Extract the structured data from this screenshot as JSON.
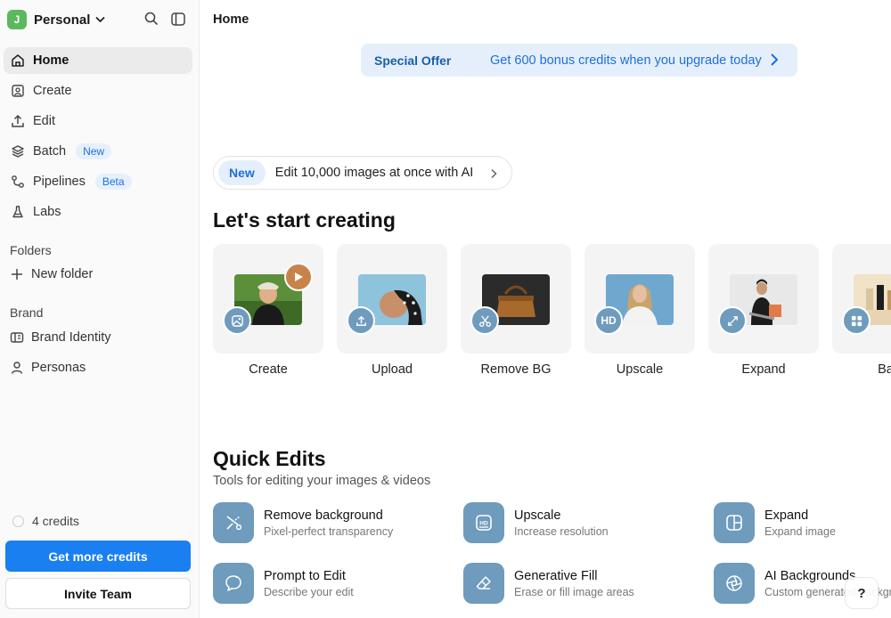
{
  "workspace": {
    "avatar_letter": "J",
    "name": "Personal"
  },
  "nav": [
    {
      "label": "Home",
      "icon": "home-icon",
      "active": true
    },
    {
      "label": "Create",
      "icon": "image-frame-icon"
    },
    {
      "label": "Edit",
      "icon": "upload-icon"
    },
    {
      "label": "Batch",
      "icon": "layers-icon",
      "badge": "New"
    },
    {
      "label": "Pipelines",
      "icon": "pipeline-icon",
      "badge": "Beta"
    },
    {
      "label": "Labs",
      "icon": "flask-icon"
    }
  ],
  "folders": {
    "heading": "Folders",
    "new_folder": "New folder"
  },
  "brand": {
    "heading": "Brand",
    "items": [
      "Brand Identity",
      "Personas"
    ]
  },
  "sidebar_footer": {
    "credits": "4 credits",
    "get_more": "Get more credits",
    "invite": "Invite Team"
  },
  "main": {
    "page_title": "Home",
    "offer": {
      "title": "Special Offer",
      "text": "Get 600 bonus credits when you upgrade today"
    },
    "new_banner": {
      "tag": "New",
      "text": "Edit 10,000 images at once with AI"
    },
    "start_heading": "Let's start creating",
    "cards": [
      {
        "label": "Create",
        "icon": "image-icon"
      },
      {
        "label": "Upload",
        "icon": "upload-icon"
      },
      {
        "label": "Remove BG",
        "icon": "scissors-icon"
      },
      {
        "label": "Upscale",
        "icon": "hd-icon",
        "badge_text": "HD"
      },
      {
        "label": "Expand",
        "icon": "expand-arrows-icon"
      },
      {
        "label": "Bat",
        "icon": "grid-icon"
      }
    ],
    "quick_heading": "Quick Edits",
    "quick_sub": "Tools for editing your images & videos",
    "quick_edits": [
      {
        "title": "Remove background",
        "desc": "Pixel-perfect transparency",
        "icon": "scissors-icon"
      },
      {
        "title": "Upscale",
        "desc": "Increase resolution",
        "icon": "hd-icon"
      },
      {
        "title": "Expand",
        "desc": "Expand image",
        "icon": "expand-frame-icon"
      },
      {
        "title": "Prompt to Edit",
        "desc": "Describe your edit",
        "icon": "chat-bubble-icon"
      },
      {
        "title": "Generative Fill",
        "desc": "Erase or fill image areas",
        "icon": "eraser-icon"
      },
      {
        "title": "AI Backgrounds",
        "desc": "Custom generated backgr",
        "icon": "aperture-icon"
      }
    ],
    "help": "?"
  },
  "colors": {
    "accent": "#1a7ff0",
    "icon_tile": "#6f9bbd",
    "offer_bg": "#e4effb",
    "avatar": "#5cb85c"
  }
}
